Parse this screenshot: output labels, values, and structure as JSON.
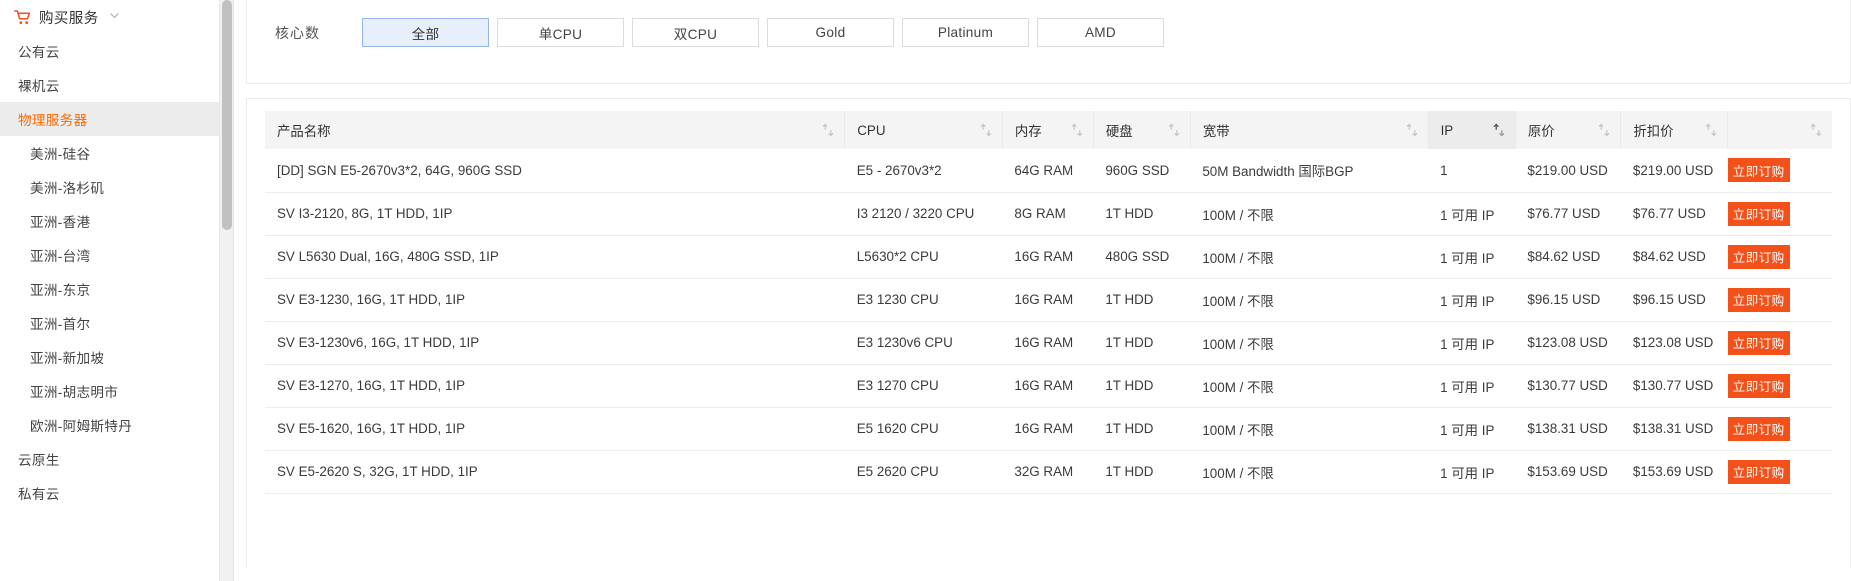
{
  "sidebar": {
    "header": {
      "label": "购买服务",
      "cart_icon": "cart-icon",
      "chevron": "chevron-down-icon"
    },
    "items": [
      {
        "label": "公有云",
        "level": 1,
        "active": false
      },
      {
        "label": "裸机云",
        "level": 1,
        "active": false
      },
      {
        "label": "物理服务器",
        "level": 1,
        "active": true
      },
      {
        "label": "美洲-硅谷",
        "level": 2,
        "active": false
      },
      {
        "label": "美洲-洛杉矶",
        "level": 2,
        "active": false
      },
      {
        "label": "亚洲-香港",
        "level": 2,
        "active": false
      },
      {
        "label": "亚洲-台湾",
        "level": 2,
        "active": false
      },
      {
        "label": "亚洲-东京",
        "level": 2,
        "active": false
      },
      {
        "label": "亚洲-首尔",
        "level": 2,
        "active": false
      },
      {
        "label": "亚洲-新加坡",
        "level": 2,
        "active": false
      },
      {
        "label": "亚洲-胡志明市",
        "level": 2,
        "active": false
      },
      {
        "label": "欧洲-阿姆斯特丹",
        "level": 2,
        "active": false
      },
      {
        "label": "云原生",
        "level": 1,
        "active": false
      },
      {
        "label": "私有云",
        "level": 1,
        "active": false
      }
    ]
  },
  "filter": {
    "label": "核心数",
    "options": [
      {
        "label": "全部",
        "selected": true
      },
      {
        "label": "单CPU",
        "selected": false
      },
      {
        "label": "双CPU",
        "selected": false
      },
      {
        "label": "Gold",
        "selected": false
      },
      {
        "label": "Platinum",
        "selected": false
      },
      {
        "label": "AMD",
        "selected": false
      }
    ]
  },
  "table": {
    "columns": [
      {
        "label": "产品名称",
        "sortable": true,
        "sorted": false
      },
      {
        "label": "CPU",
        "sortable": true,
        "sorted": false
      },
      {
        "label": "内存",
        "sortable": true,
        "sorted": false
      },
      {
        "label": "硬盘",
        "sortable": true,
        "sorted": false
      },
      {
        "label": "宽带",
        "sortable": true,
        "sorted": false
      },
      {
        "label": "IP",
        "sortable": true,
        "sorted": true
      },
      {
        "label": "原价",
        "sortable": true,
        "sorted": false
      },
      {
        "label": "折扣价",
        "sortable": true,
        "sorted": false
      },
      {
        "label": "",
        "sortable": true,
        "sorted": false
      }
    ],
    "order_button_label": "立即订购",
    "rows": [
      {
        "name": "[DD] SGN E5-2670v3*2, 64G, 960G SSD",
        "cpu": "E5 - 2670v3*2",
        "memory": "64G RAM",
        "disk": "960G SSD",
        "bandwidth": "50M Bandwidth 国际BGP",
        "ip": "1",
        "price": "$219.00 USD",
        "discount": "$219.00 USD"
      },
      {
        "name": "SV I3-2120, 8G, 1T HDD, 1IP",
        "cpu": "I3 2120 / 3220 CPU",
        "memory": "8G RAM",
        "disk": "1T HDD",
        "bandwidth": "100M / 不限",
        "ip": "1 可用 IP",
        "price": "$76.77 USD",
        "discount": "$76.77 USD"
      },
      {
        "name": "SV L5630 Dual, 16G, 480G SSD, 1IP",
        "cpu": "L5630*2 CPU",
        "memory": "16G RAM",
        "disk": "480G SSD",
        "bandwidth": "100M / 不限",
        "ip": "1 可用 IP",
        "price": "$84.62 USD",
        "discount": "$84.62 USD"
      },
      {
        "name": "SV E3-1230, 16G, 1T HDD, 1IP",
        "cpu": "E3 1230 CPU",
        "memory": "16G RAM",
        "disk": "1T HDD",
        "bandwidth": "100M / 不限",
        "ip": "1 可用 IP",
        "price": "$96.15 USD",
        "discount": "$96.15 USD"
      },
      {
        "name": "SV E3-1230v6, 16G, 1T HDD, 1IP",
        "cpu": "E3 1230v6 CPU",
        "memory": "16G RAM",
        "disk": "1T HDD",
        "bandwidth": "100M / 不限",
        "ip": "1 可用 IP",
        "price": "$123.08 USD",
        "discount": "$123.08 USD"
      },
      {
        "name": "SV E3-1270, 16G, 1T HDD, 1IP",
        "cpu": "E3 1270 CPU",
        "memory": "16G RAM",
        "disk": "1T HDD",
        "bandwidth": "100M / 不限",
        "ip": "1 可用 IP",
        "price": "$130.77 USD",
        "discount": "$130.77 USD"
      },
      {
        "name": "SV E5-1620, 16G, 1T HDD, 1IP",
        "cpu": "E5 1620 CPU",
        "memory": "16G RAM",
        "disk": "1T HDD",
        "bandwidth": "100M / 不限",
        "ip": "1 可用 IP",
        "price": "$138.31 USD",
        "discount": "$138.31 USD"
      },
      {
        "name": "SV E5-2620 S, 32G, 1T HDD, 1IP",
        "cpu": "E5 2620 CPU",
        "memory": "32G RAM",
        "disk": "1T HDD",
        "bandwidth": "100M / 不限",
        "ip": "1 可用 IP",
        "price": "$153.69 USD",
        "discount": "$153.69 USD"
      }
    ]
  },
  "colors": {
    "accent_orange": "#ff6a00",
    "button_orange": "#f4501a",
    "selected_chip_bg": "#e8effc",
    "selected_chip_border": "#97b6e8",
    "header_bg": "#f4f4f4"
  }
}
